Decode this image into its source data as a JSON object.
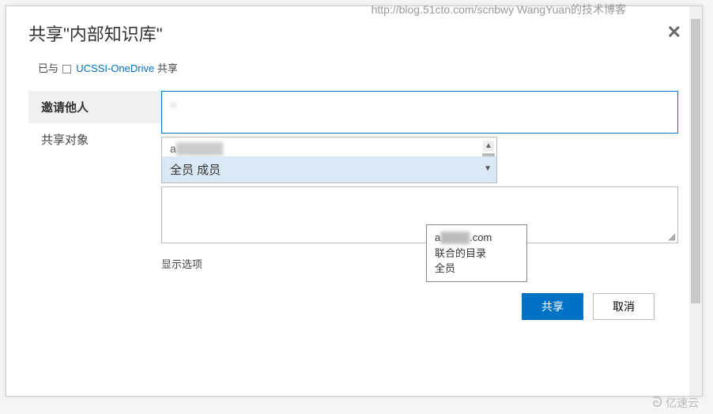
{
  "watermark_top": "http://blog.51cto.com/scnbwy WangYuan的技术博客",
  "dialog": {
    "title": "共享\"内部知识库\"",
    "close_glyph": "✕"
  },
  "shared_with": {
    "prefix": "已与",
    "link": "UCSSI-OneDrive",
    "suffix": "共享"
  },
  "sidebar": {
    "items": [
      {
        "label": "邀请他人",
        "active": true
      },
      {
        "label": "共享对象",
        "active": false
      }
    ]
  },
  "main": {
    "people_hint": "a",
    "dropdown": {
      "line1_visible": "a",
      "selected": "全员 成员",
      "scroll_up_glyph": "▲",
      "arrow_glyph": "▼"
    },
    "show_options": "显示选项"
  },
  "tooltip": {
    "line1_visible_start": "a",
    "line1_visible_end": ".com",
    "line2": "联合的目录",
    "line3": "全员"
  },
  "footer": {
    "share": "共享",
    "cancel": "取消"
  },
  "watermark_logo": {
    "glyph": "ᘐ",
    "text": "亿速云"
  }
}
